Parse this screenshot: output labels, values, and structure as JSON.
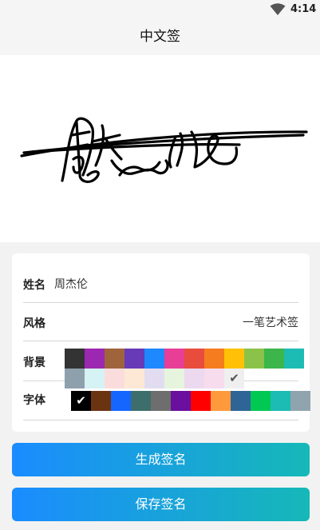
{
  "status_bar": {
    "time": "4:14",
    "wifi_icon": "wifi-icon"
  },
  "app_bar": {
    "title": "中文签"
  },
  "preview": {
    "signature_text": "周杰伦"
  },
  "form": {
    "name_label": "姓名",
    "name_value": "周杰伦",
    "style_label": "风格",
    "style_value": "一笔艺术签",
    "background_label": "背景",
    "background_colors": [
      "#333333",
      "#9c27b0",
      "#a0643c",
      "#673ab7",
      "#1e88ff",
      "#e83e96",
      "#e74c3c",
      "#f57c1f",
      "#ffc107",
      "#8bc34a",
      "#3cb54a",
      "#1cbcb4",
      "#8fa0ad",
      "#d5f2f4",
      "#fbdcdc",
      "#fde8d6",
      "#e2dcf0",
      "#e6f4de",
      "#ecd9f0",
      "#f7dced",
      "#efefef"
    ],
    "background_selected_index": 20,
    "font_label": "字体",
    "font_colors": [
      "#000000",
      "#6b3410",
      "#1565ff",
      "#3e6e6b",
      "#6e6e6e",
      "#6a0f9e",
      "#ff0000",
      "#ff9a3c",
      "#2f6496",
      "#00c853",
      "#1cbcb4",
      "#90a4ae"
    ],
    "font_selected_index": 0,
    "check_icon": "check-icon"
  },
  "buttons": {
    "generate": "生成签名",
    "save": "保存签名"
  }
}
